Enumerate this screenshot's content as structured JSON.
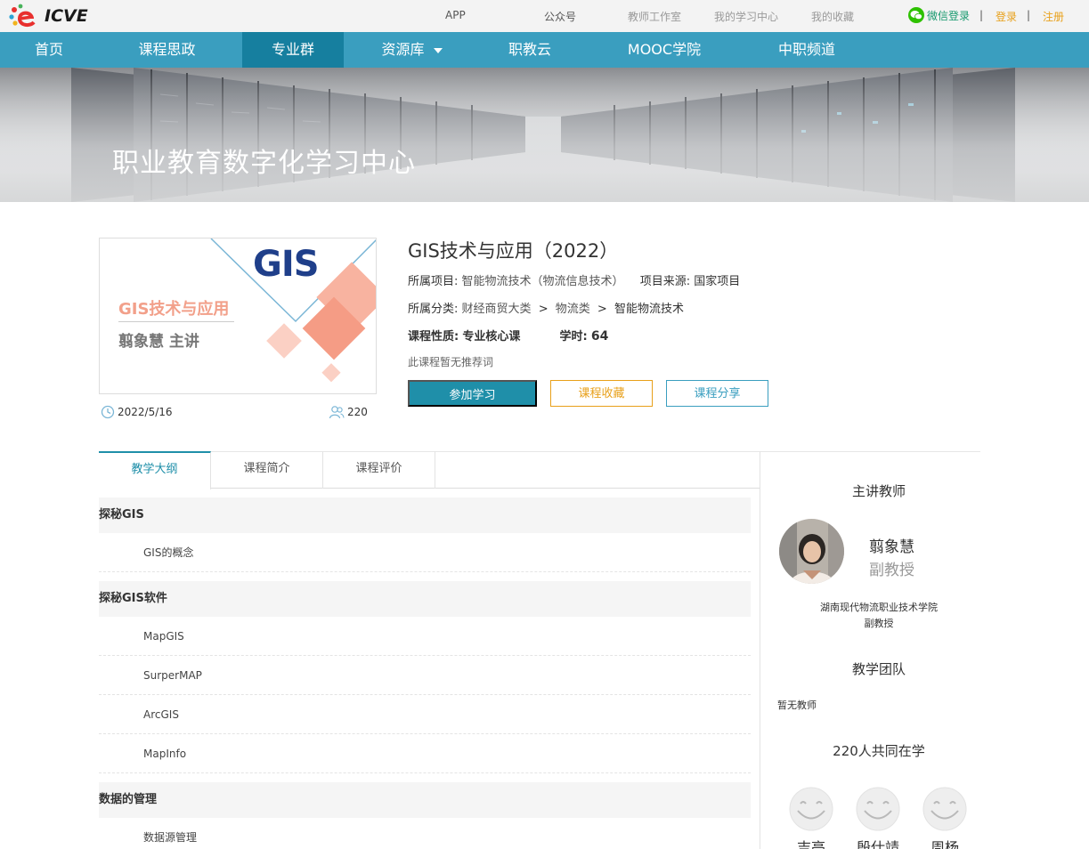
{
  "logo": {
    "text": "ICVE"
  },
  "topbar": {
    "links": [
      "APP",
      "公众号",
      "教师工作室",
      "我的学习中心",
      "我的收藏"
    ],
    "wechat_login": "微信登录",
    "separator": "|",
    "login": "登录",
    "register": "注册"
  },
  "nav": {
    "items": [
      "首页",
      "课程思政",
      "专业群",
      "资源库",
      "职教云",
      "MOOC学院",
      "中职频道"
    ],
    "active": "专业群"
  },
  "banner": {
    "title": "职业教育数字化学习中心"
  },
  "course": {
    "cover_logo": "GIS",
    "cover_title": "GIS技术与应用",
    "cover_author": "翦象慧 主讲",
    "date": "2022/5/16",
    "learners": "220",
    "title": "GIS技术与应用（2022）",
    "project_label": "所属项目:",
    "project_value": "智能物流技术（物流信息技术）",
    "source_label": "项目来源:",
    "source_value": "国家项目",
    "category_label": "所属分类:",
    "category_path": [
      "财经商贸大类",
      "物流类",
      "智能物流技术"
    ],
    "category_sep": ">",
    "nature_label": "课程性质:",
    "nature_value": "专业核心课",
    "hours_label": "学时:",
    "hours_value": "64",
    "no_recommend": "此课程暂无推荐词",
    "join_button": "参加学习",
    "favorite_button": "课程收藏",
    "share_button": "课程分享"
  },
  "tabs": {
    "items": [
      "教学大纲",
      "课程简介",
      "课程评价"
    ],
    "active": "教学大纲"
  },
  "syllabus": [
    {
      "chapter": "探秘GIS",
      "lessons": [
        "GIS的概念"
      ]
    },
    {
      "chapter": "探秘GIS软件",
      "lessons": [
        "MapGIS",
        "SurperMAP",
        "ArcGIS",
        "MapInfo"
      ]
    },
    {
      "chapter": "数据的管理",
      "lessons": [
        "数据源管理"
      ]
    }
  ],
  "sidebar": {
    "lecturer_heading": "主讲教师",
    "teacher_name": "翦象慧",
    "teacher_title": "副教授",
    "teacher_school": "湖南现代物流职业技术学院",
    "teacher_rank": "副教授",
    "team_heading": "教学团队",
    "no_teacher": "暂无教师",
    "learners_heading": "220人共同在学",
    "students": [
      "吉亮",
      "殷仕靖",
      "周杨"
    ]
  },
  "colors": {
    "nav_bg": "#3a9ebf",
    "nav_active": "#167f9f",
    "primary": "#1f8fa9",
    "accent_orange": "#e8a01a"
  }
}
